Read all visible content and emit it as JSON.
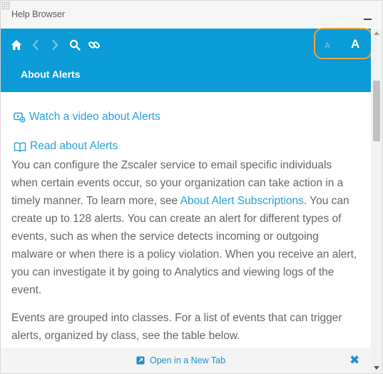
{
  "window": {
    "title": "Help Browser"
  },
  "toolbar": {
    "icons": [
      "home-icon",
      "back-icon",
      "forward-icon",
      "search-icon",
      "link-icon"
    ],
    "font_small_label": "A",
    "font_large_label": "A",
    "active_font_size": "large"
  },
  "article": {
    "title": "About Alerts",
    "video_link": "Watch a video about Alerts",
    "read_link": "Read about Alerts",
    "para1_before": "You can configure the Zscaler service to email specific individuals when certain events occur, so your organization can take action in a timely manner. To learn more, see ",
    "para1_link": "About Alert Subscriptions",
    "para1_after": ". You can create up to 128 alerts. You can create an alert for different types of events, such as when the service detects incoming or outgoing malware or when there is a policy violation. When you receive an alert, you can investigate it by going to Analytics and viewing logs of the event.",
    "para2": "Events are grouped into classes. For a list of events that can trigger alerts, organized by class, see the table below."
  },
  "footer": {
    "open_new_tab": "Open in a New Tab",
    "close_symbol": "✖"
  },
  "colors": {
    "header_bg": "#0b9bd7",
    "link": "#2a9fd6",
    "body_text": "#666666",
    "highlight": "#f0a43a"
  }
}
